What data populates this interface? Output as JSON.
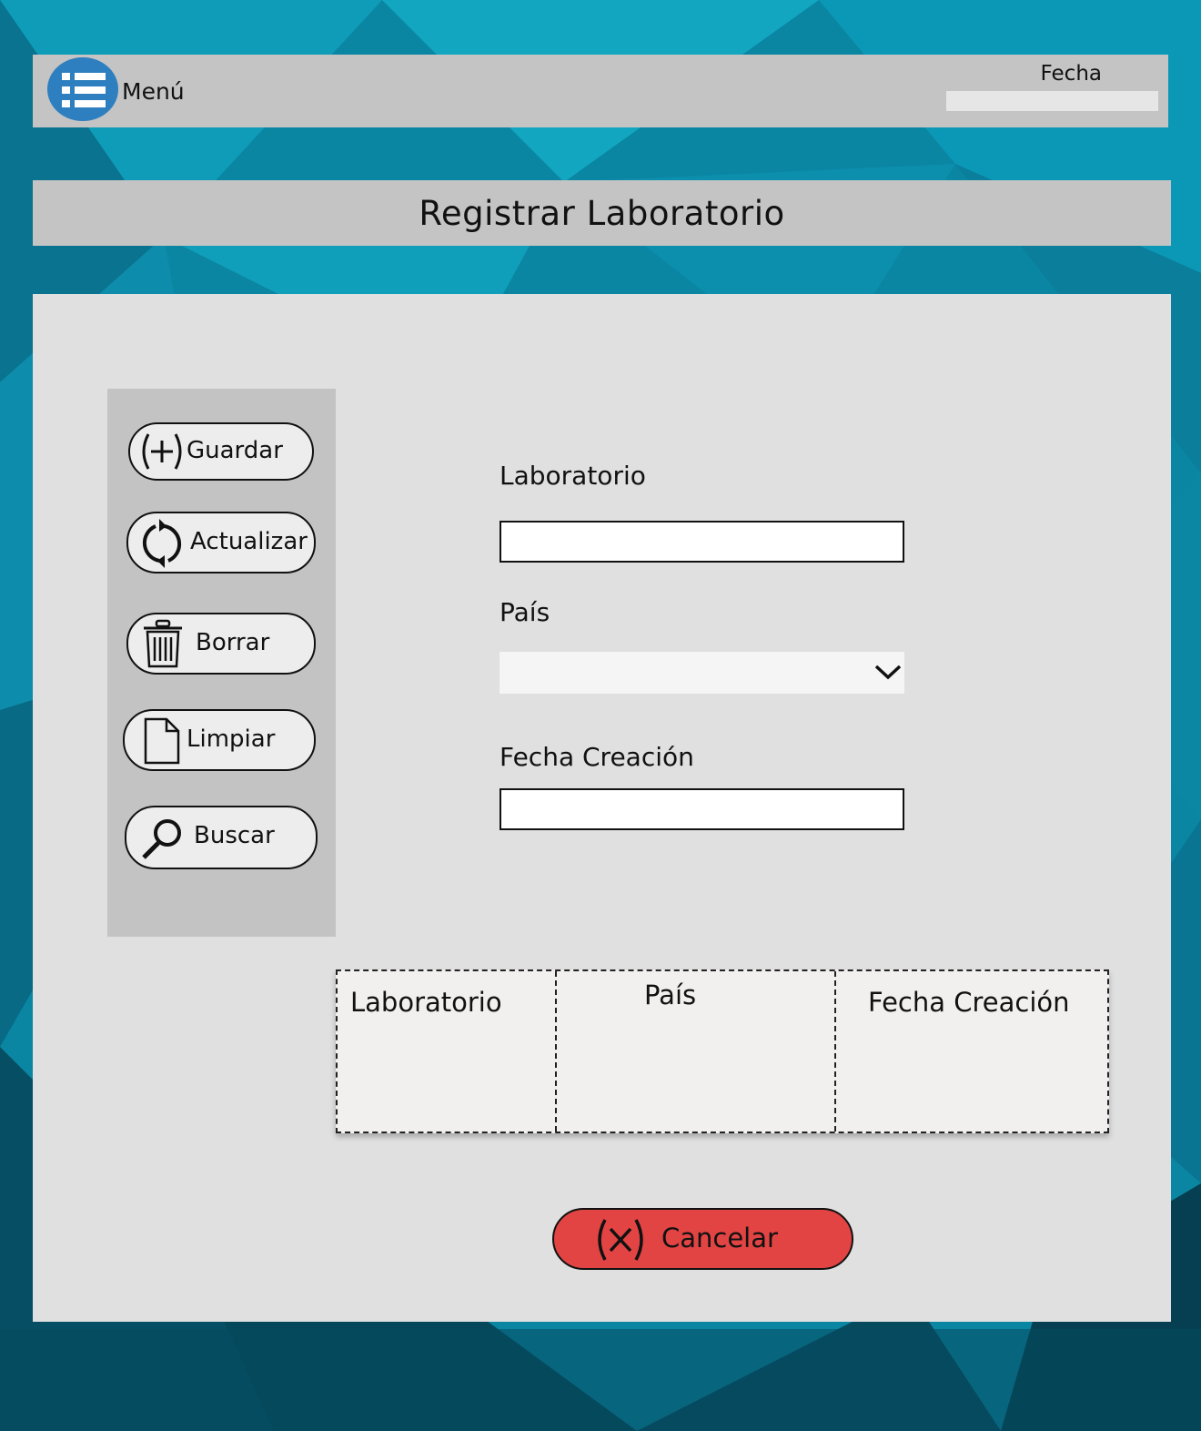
{
  "header": {
    "menu_label": "Menú",
    "date_label": "Fecha",
    "date_value": ""
  },
  "page": {
    "title": "Registrar Laboratorio"
  },
  "actions": [
    {
      "label": "Guardar",
      "icon": "plus-circle-icon"
    },
    {
      "label": "Actualizar",
      "icon": "refresh-icon"
    },
    {
      "label": "Borrar",
      "icon": "trash-icon"
    },
    {
      "label": "Limpiar",
      "icon": "document-icon"
    },
    {
      "label": "Buscar",
      "icon": "search-icon"
    }
  ],
  "form": {
    "laboratorio": {
      "label": "Laboratorio",
      "value": ""
    },
    "pais": {
      "label": "País",
      "selected": ""
    },
    "fecha_creacion": {
      "label": "Fecha Creación",
      "value": ""
    }
  },
  "table": {
    "columns": [
      "Laboratorio",
      "País",
      "Fecha Creación"
    ],
    "rows": []
  },
  "cancel": {
    "label": "Cancelar",
    "icon": "x-circle-icon"
  },
  "colors": {
    "bar_gray": "#c4c4c4",
    "panel_gray": "#e0e0e0",
    "menu_blue": "#2e7fbf",
    "cancel_red": "#e24444",
    "background_teal": "#0a8aa6"
  }
}
